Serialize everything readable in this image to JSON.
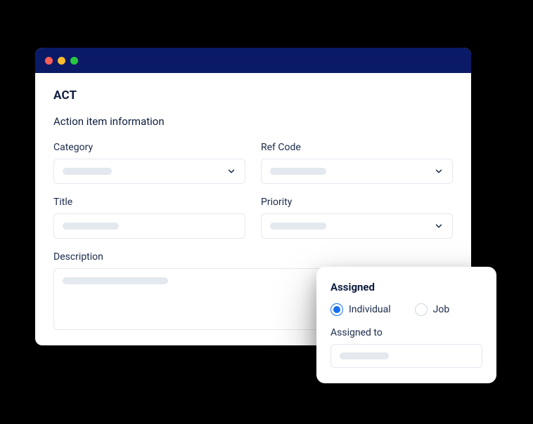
{
  "window": {
    "code": "ACT",
    "subtitle": "Action item information"
  },
  "fields": {
    "category": {
      "label": "Category"
    },
    "refcode": {
      "label": "Ref Code"
    },
    "title": {
      "label": "Title"
    },
    "priority": {
      "label": "Priority"
    },
    "description": {
      "label": "Description"
    }
  },
  "panel": {
    "title": "Assigned",
    "options": {
      "individual": "Individual",
      "job": "Job"
    },
    "assigned_to_label": "Assigned to"
  }
}
